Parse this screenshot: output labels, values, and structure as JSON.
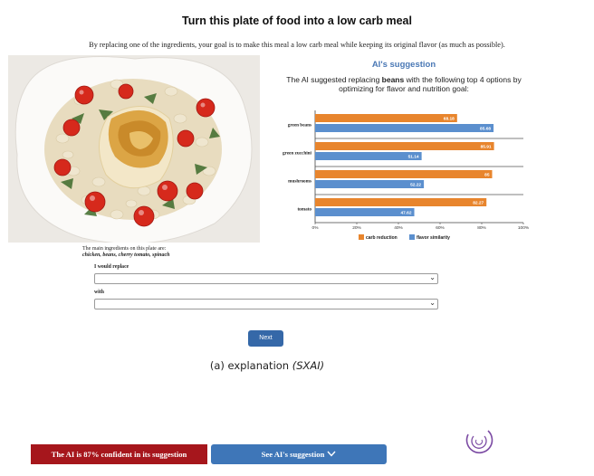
{
  "header": {
    "title": "Turn this plate of food into a low carb meal",
    "intro": "By replacing one of the ingredients, your goal is to make this meal a low carb meal while keeping its original flavor (as much as possible)."
  },
  "ai": {
    "title": "AI's suggestion",
    "desc_prefix": "The AI suggested replacing ",
    "desc_bold": "beans",
    "desc_suffix": " with the following top 4 options by optimizing for flavor and nutrition goal:"
  },
  "chart_data": {
    "type": "bar",
    "orientation": "horizontal",
    "categories": [
      "green beans",
      "green zucchini",
      "mushrooms",
      "tomato"
    ],
    "series": [
      {
        "name": "carb reduction",
        "color": "#e8852d",
        "values": [
          68.18,
          85.91,
          85,
          82.27
        ]
      },
      {
        "name": "flavor similarity",
        "color": "#5b8fce",
        "values": [
          85.68,
          51.14,
          52.22,
          47.62
        ]
      }
    ],
    "x_ticks": [
      "0%",
      "20%",
      "40%",
      "60%",
      "80%",
      "100%"
    ],
    "xlim": [
      0,
      100
    ],
    "legend_position": "bottom"
  },
  "ingredients": {
    "label": "The main ingredients on this plate are:",
    "list": "chicken, beans, cherry tomato, spinach"
  },
  "form": {
    "replace_label": "I would replace",
    "replace_value": "",
    "with_label": "with",
    "with_value": "",
    "chevron": "⌄"
  },
  "next_label": "Next",
  "caption": {
    "main": "(a) explanation ",
    "italic": "(SXAI)"
  },
  "confidence_text": "The AI is 87% confident in its suggestion",
  "see_suggestion": {
    "label": "See AI's suggestion",
    "icon": "chevron-down-icon"
  }
}
